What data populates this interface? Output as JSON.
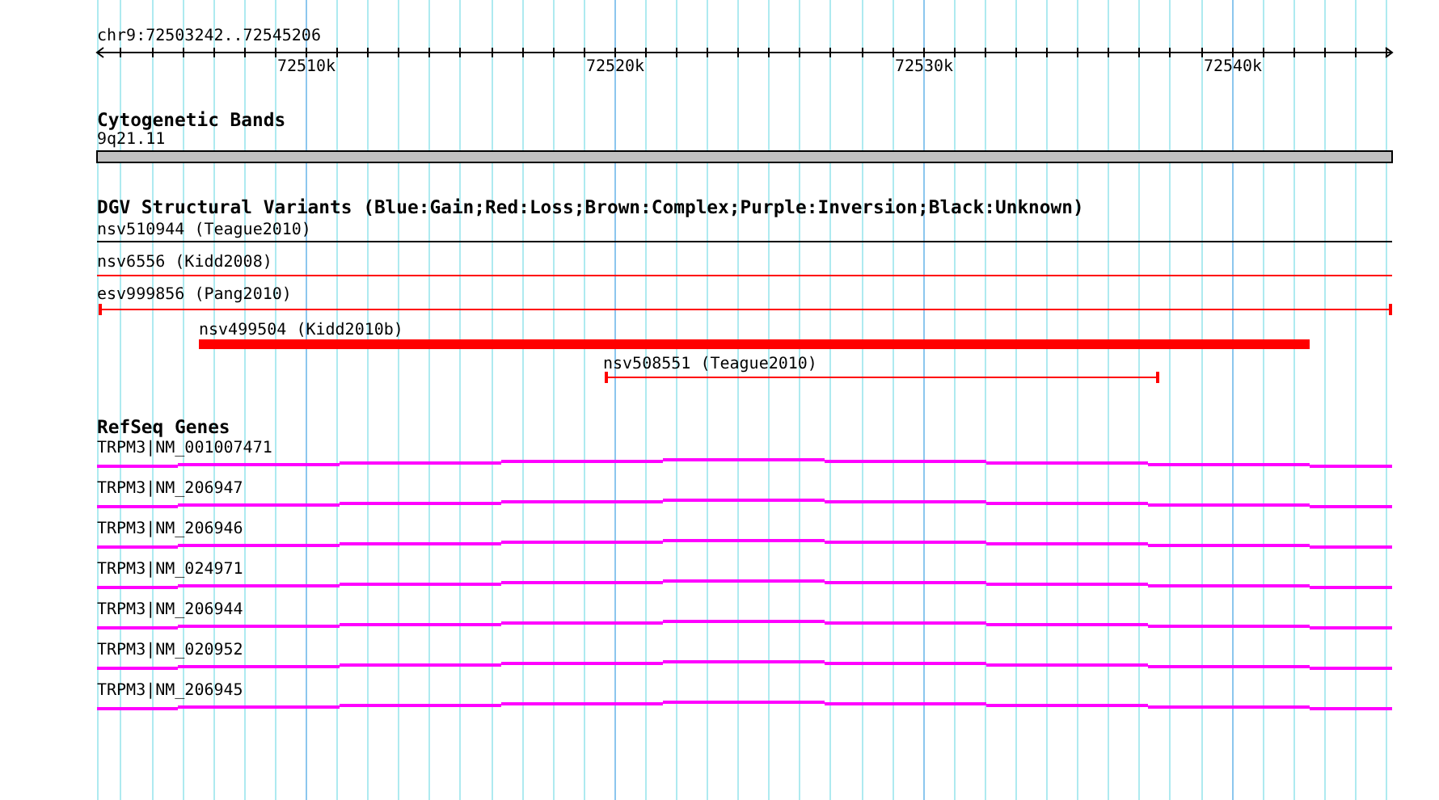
{
  "ruler": {
    "range": "chr9:72503242..72545206",
    "ticks": [
      "72510k",
      "72520k",
      "72530k",
      "72540k"
    ]
  },
  "tracks": [
    {
      "title": "Cytogenetic Bands",
      "kind": "bands",
      "features": [
        {
          "label": "9q21.11"
        }
      ]
    },
    {
      "title": "DGV Structural Variants (Blue:Gain;Red:Loss;Brown:Complex;Purple:Inversion;Black:Unknown)",
      "kind": "variants",
      "features": [
        {
          "label": "nsv510944 (Teague2010)",
          "color": "#000000"
        },
        {
          "label": "nsv6556 (Kidd2008)",
          "color": "#ff0000"
        },
        {
          "label": "esv999856 (Pang2010)",
          "color": "#ff0000"
        },
        {
          "label": "nsv499504 (Kidd2010b)",
          "color": "#ff0000"
        },
        {
          "label": "nsv508551 (Teague2010)",
          "color": "#ff0000"
        }
      ]
    },
    {
      "title": "RefSeq Genes",
      "kind": "genes",
      "features": [
        {
          "label": "TRPM3|NM_001007471"
        },
        {
          "label": "TRPM3|NM_206947"
        },
        {
          "label": "TRPM3|NM_206946"
        },
        {
          "label": "TRPM3|NM_024971"
        },
        {
          "label": "TRPM3|NM_206944"
        },
        {
          "label": "TRPM3|NM_020952"
        },
        {
          "label": "TRPM3|NM_206945"
        }
      ]
    }
  ]
}
